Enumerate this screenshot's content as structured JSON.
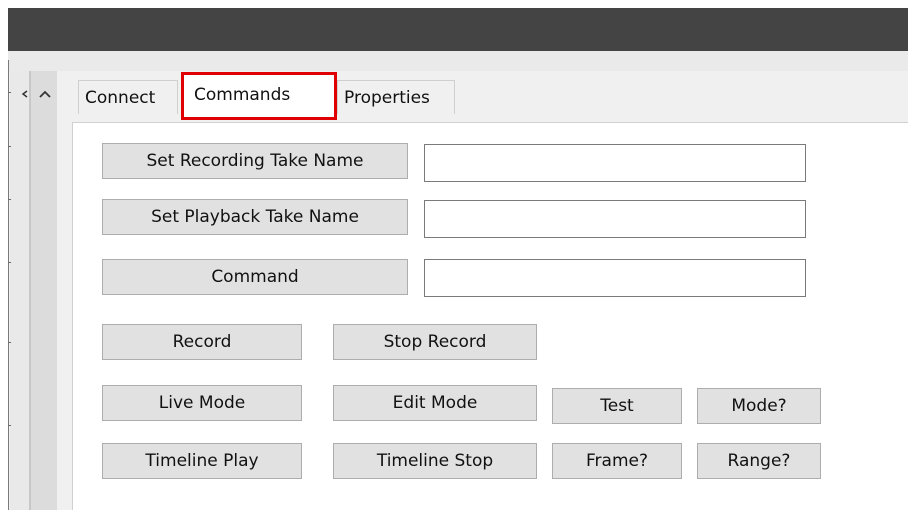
{
  "tabs": [
    {
      "label": "Connect",
      "active": false
    },
    {
      "label": "Commands",
      "active": true
    },
    {
      "label": "Properties",
      "active": false
    }
  ],
  "commands": {
    "set_recording_take_name": {
      "label": "Set Recording Take Name",
      "value": ""
    },
    "set_playback_take_name": {
      "label": "Set Playback Take Name",
      "value": ""
    },
    "command": {
      "label": "Command",
      "value": ""
    },
    "record_label": "Record",
    "stop_record_label": "Stop Record",
    "live_mode_label": "Live Mode",
    "edit_mode_label": "Edit Mode",
    "test_label": "Test",
    "mode_query_label": "Mode?",
    "timeline_play_label": "Timeline Play",
    "timeline_stop_label": "Timeline Stop",
    "frame_query_label": "Frame?",
    "range_query_label": "Range?"
  },
  "icons": {
    "left_arrow": "arrow-left-icon",
    "up_arrow": "chevron-up-icon"
  },
  "colors": {
    "title_bar": "#444444",
    "highlight": "#e00000",
    "button_bg": "#e1e1e1"
  }
}
